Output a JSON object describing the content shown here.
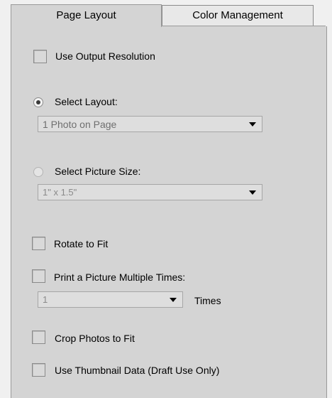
{
  "tabs": {
    "page_layout": "Page Layout",
    "color_management": "Color Management"
  },
  "options": {
    "use_output_resolution": {
      "label": "Use Output Resolution",
      "checked": false
    },
    "select_layout": {
      "label": "Select Layout:",
      "selected": true,
      "value": "1 Photo on Page"
    },
    "select_picture_size": {
      "label": "Select Picture Size:",
      "selected": false,
      "value": "1\" x 1.5\""
    },
    "rotate_to_fit": {
      "label": "Rotate to Fit",
      "checked": false
    },
    "print_multiple": {
      "label": "Print a Picture Multiple Times:",
      "checked": false,
      "value": "1",
      "unit": "Times"
    },
    "crop_to_fit": {
      "label": "Crop Photos to Fit",
      "checked": false
    },
    "use_thumbnail": {
      "label": "Use Thumbnail Data (Draft Use Only)",
      "checked": false
    }
  }
}
